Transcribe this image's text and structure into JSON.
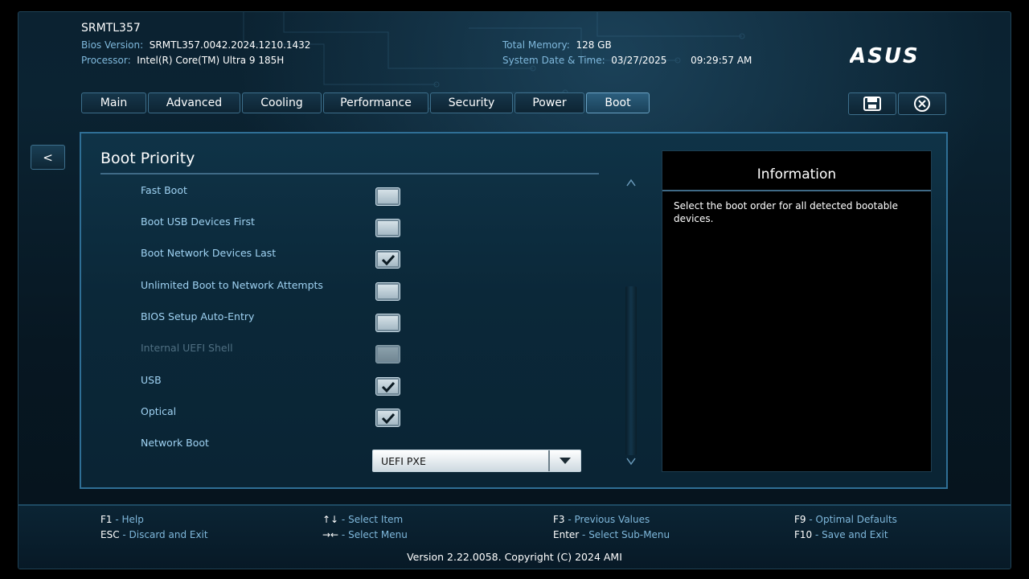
{
  "header": {
    "model": "SRMTL357",
    "bios_version_label": "Bios Version:",
    "bios_version": "SRMTL357.0042.2024.1210.1432",
    "processor_label": "Processor:",
    "processor": "Intel(R) Core(TM) Ultra 9 185H",
    "total_memory_label": "Total Memory:",
    "total_memory": "128 GB",
    "datetime_label": "System Date & Time:",
    "date": "03/27/2025",
    "time": "09:29:57 AM",
    "brand": "ASUS"
  },
  "tabs": [
    {
      "label": "Main"
    },
    {
      "label": "Advanced"
    },
    {
      "label": "Cooling"
    },
    {
      "label": "Performance"
    },
    {
      "label": "Security"
    },
    {
      "label": "Power"
    },
    {
      "label": "Boot",
      "active": true
    }
  ],
  "toolbar": {
    "save_icon": "save-icon",
    "exit_icon": "close-icon"
  },
  "back_label": "<",
  "section": {
    "title": "Boot Priority"
  },
  "settings": [
    {
      "label": "Fast Boot",
      "checked": false,
      "disabled": false
    },
    {
      "label": "Boot USB Devices First",
      "checked": false,
      "disabled": false
    },
    {
      "label": "Boot Network Devices Last",
      "checked": true,
      "disabled": false
    },
    {
      "label": "Unlimited Boot to Network Attempts",
      "checked": false,
      "disabled": false
    },
    {
      "label": "BIOS Setup Auto-Entry",
      "checked": false,
      "disabled": false
    },
    {
      "label": "Internal UEFI Shell",
      "checked": false,
      "disabled": true
    },
    {
      "label": "USB",
      "checked": true,
      "disabled": false
    },
    {
      "label": "Optical",
      "checked": true,
      "disabled": false
    }
  ],
  "network_boot": {
    "label": "Network Boot",
    "value": "UEFI PXE"
  },
  "scroll": {
    "up": "^",
    "down": "v"
  },
  "info": {
    "title": "Information",
    "text": "Select the boot order for all detected bootable devices."
  },
  "footer": {
    "f1_key": "F1",
    "f1_desc": "Help",
    "esc_key": "ESC",
    "esc_desc": "Discard and Exit",
    "arrows_ud_key": "↑↓",
    "arrows_ud_desc": "Select Item",
    "arrows_lr_key": "→←",
    "arrows_lr_desc": "Select Menu",
    "f3_key": "F3",
    "f3_desc": "Previous Values",
    "enter_key": "Enter",
    "enter_desc": "Select Sub-Menu",
    "f9_key": "F9",
    "f9_desc": "Optimal Defaults",
    "f10_key": "F10",
    "f10_desc": "Save and Exit",
    "sep": " - ",
    "version": "Version 2.22.0058. Copyright (C) 2024 AMI"
  },
  "colors": {
    "accent": "#9fd2f2",
    "border": "#2f6f96",
    "key_desc": "#7fb8dc"
  }
}
